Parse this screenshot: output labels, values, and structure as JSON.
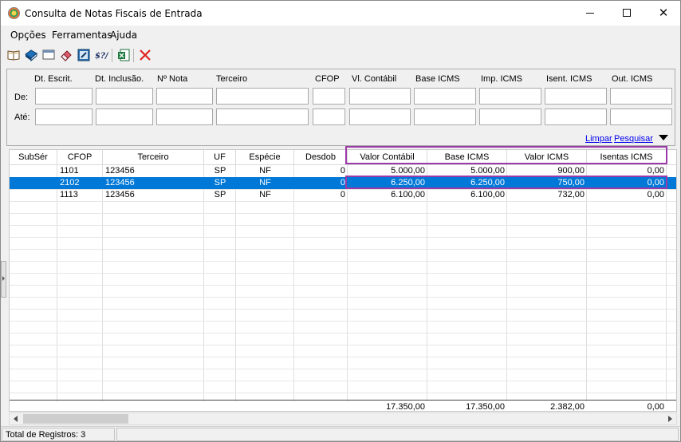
{
  "window": {
    "title": "Consulta de Notas Fiscais de Entrada"
  },
  "menu": [
    "Opções",
    "Ferramentas",
    "Ajuda"
  ],
  "toolbar": {
    "buttons": [
      "open-book-icon",
      "book-icon",
      "window-icon",
      "eraser-icon",
      "edit-icon",
      "signature-icon",
      "excel-export-icon",
      "delete-icon"
    ]
  },
  "filters": {
    "fields": [
      "Dt. Escrit.",
      "Dt. Inclusão.",
      "Nº Nota",
      "Terceiro",
      "CFOP",
      "Vl. Contábil",
      "Base ICMS",
      "Imp. ICMS",
      "Isent. ICMS",
      "Out. ICMS"
    ],
    "row_labels": [
      "De:",
      "Até:"
    ],
    "clear_label": "Limpar",
    "search_label": "Pesquisar"
  },
  "grid": {
    "columns": [
      "SubSér",
      "CFOP",
      "Terceiro",
      "UF",
      "Espécie",
      "Desdob",
      "Valor Contábil",
      "Base ICMS",
      "Valor ICMS",
      "Isentas ICMS"
    ],
    "rows": [
      [
        "",
        "1101",
        "123456",
        "SP",
        "NF",
        "0",
        "5.000,00",
        "5.000,00",
        "900,00",
        "0,00"
      ],
      [
        "",
        "2102",
        "123456",
        "SP",
        "NF",
        "0",
        "6.250,00",
        "6.250,00",
        "750,00",
        "0,00"
      ],
      [
        "",
        "1113",
        "123456",
        "SP",
        "NF",
        "0",
        "6.100,00",
        "6.100,00",
        "732,00",
        "0,00"
      ]
    ],
    "selected_row": 1,
    "totals": [
      "17.350,00",
      "17.350,00",
      "2.382,00",
      "0,00"
    ]
  },
  "status": {
    "text": "Total de Registros: 3"
  },
  "colors": {
    "selection": "#0078d7",
    "highlight": "#9b3aa8"
  }
}
